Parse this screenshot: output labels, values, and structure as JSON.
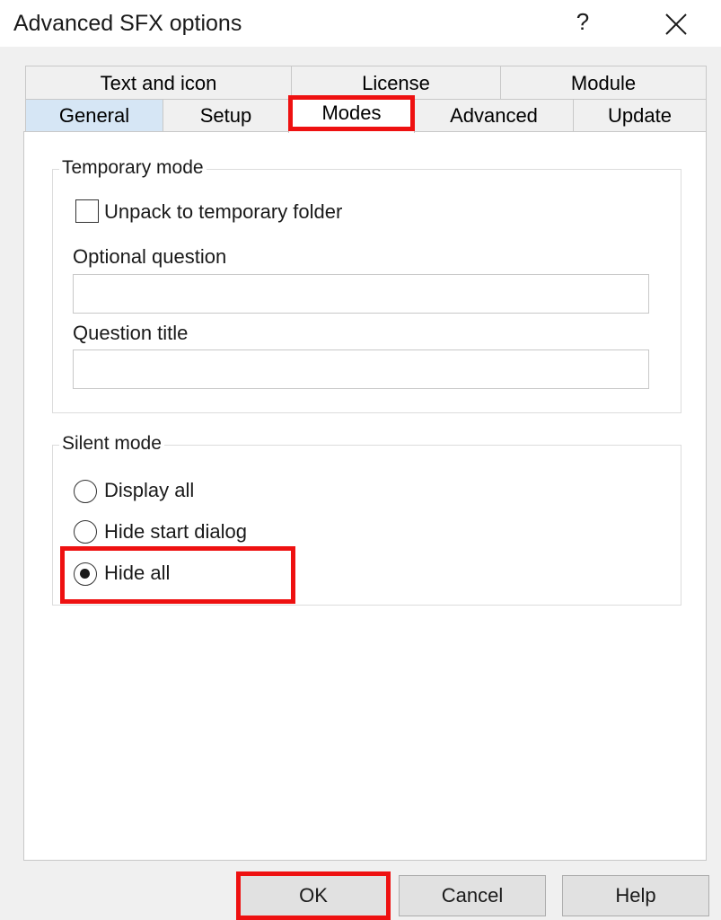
{
  "window": {
    "title": "Advanced SFX options",
    "help_glyph": "?"
  },
  "tabs": {
    "row1": [
      {
        "label": "Text and icon"
      },
      {
        "label": "License"
      },
      {
        "label": "Module"
      }
    ],
    "row2": [
      {
        "label": "General"
      },
      {
        "label": "Setup"
      },
      {
        "label": "Modes",
        "selected": true
      },
      {
        "label": "Advanced"
      },
      {
        "label": "Update"
      }
    ]
  },
  "temporary_mode": {
    "legend": "Temporary mode",
    "unpack_checkbox": {
      "label": "Unpack to temporary folder",
      "checked": false
    },
    "optional_question": {
      "label": "Optional question",
      "value": ""
    },
    "question_title": {
      "label": "Question title",
      "value": ""
    }
  },
  "silent_mode": {
    "legend": "Silent mode",
    "options": [
      {
        "label": "Display all",
        "selected": false
      },
      {
        "label": "Hide start dialog",
        "selected": false
      },
      {
        "label": "Hide all",
        "selected": true
      }
    ]
  },
  "buttons": {
    "ok": "OK",
    "cancel": "Cancel",
    "help": "Help"
  },
  "colors": {
    "highlight": "#ee1111",
    "general_tab_bg": "#d6e6f5"
  }
}
